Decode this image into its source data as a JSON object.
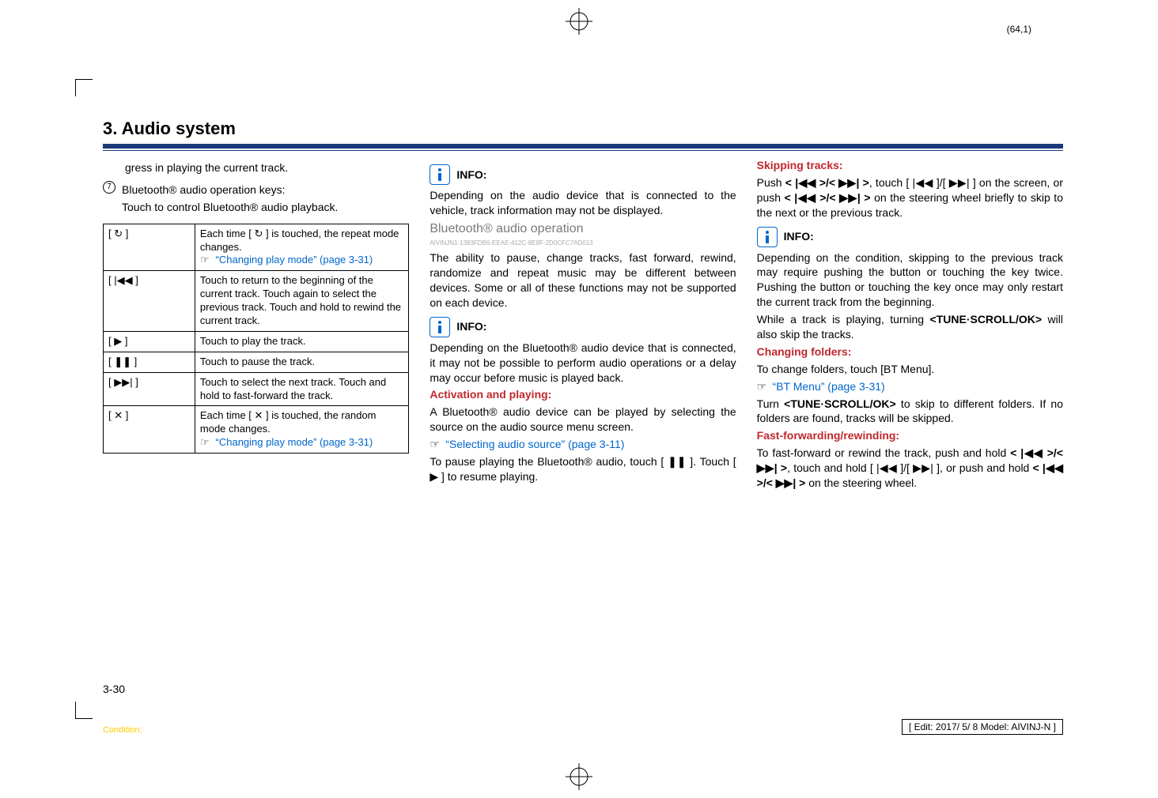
{
  "pageNumTop": "(64,1)",
  "section": {
    "number": "3.",
    "title": "Audio system"
  },
  "col1": {
    "p1": "gress in playing the current track.",
    "num7": "7",
    "bt_keys_label": "Bluetooth® audio operation keys:",
    "bt_keys_desc": "Touch to control Bluetooth® audio playback.",
    "rows": [
      {
        "key": "[ ↻ ]",
        "desc_a": "Each time [ ↻ ] is touched, the repeat mode changes.",
        "link": "“Changing play mode” (page 3-31)"
      },
      {
        "key": "[ |◀◀ ]",
        "desc_a": "Touch to return to the beginning of the current track. Touch again to select the previous track. Touch and hold to rewind the current track."
      },
      {
        "key": "[ ▶ ]",
        "desc_a": "Touch to play the track."
      },
      {
        "key": "[ ❚❚ ]",
        "desc_a": "Touch to pause the track."
      },
      {
        "key": "[ ▶▶| ]",
        "desc_a": "Touch to select the next track. Touch and hold to fast-forward the track."
      },
      {
        "key": "[ ✕ ]",
        "desc_a": "Each time [ ✕ ] is touched, the random mode changes.",
        "link": "“Changing play mode” (page 3-31)"
      }
    ]
  },
  "col2": {
    "info1_label": "INFO:",
    "info1_text": "Depending on the audio device that is connected to the vehicle, track information may not be displayed.",
    "subhead": "Bluetooth® audio operation",
    "subhead_code": "AIVINJN1-1383FDB6-EEAE-412C-8E8F-2D0CFC7AD013",
    "p1": "The ability to pause, change tracks, fast forward, rewind, randomize and repeat music may be different between devices. Some or all of these functions may not be supported on each device.",
    "info2_label": "INFO:",
    "info2_text": "Depending on the Bluetooth® audio device that is connected, it may not be possible to perform audio operations or a delay may occur before music is played back.",
    "act_head": "Activation and playing:",
    "act_p1": "A Bluetooth® audio device can be played by selecting the source on the audio source menu screen.",
    "act_link": "“Selecting audio source” (page 3-11)",
    "act_p2": "To pause playing the Bluetooth® audio, touch [ ❚❚ ]. Touch [ ▶ ] to resume playing."
  },
  "col3": {
    "skip_head": "Skipping tracks:",
    "skip_p1_a": "Push ",
    "skip_p1_b": "< |◀◀ >/< ▶▶| >",
    "skip_p1_c": ", touch [ |◀◀ ]/[ ▶▶| ] on the screen, or push ",
    "skip_p1_d": "< |◀◀ >/< ▶▶| >",
    "skip_p1_e": " on the steering wheel briefly to skip to the next or the previous track.",
    "info_label": "INFO:",
    "info_text": "Depending on the condition, skipping to the previous track may require pushing the button or touching the key twice. Pushing the button or touching the key once may only restart the current track from the beginning.",
    "tune_p_a": "While a track is playing, turning ",
    "tune_p_b": "<TUNE·SCROLL/OK>",
    "tune_p_c": " will also skip the tracks.",
    "chf_head": "Changing folders:",
    "chf_p1": "To change folders, touch [BT Menu].",
    "chf_link": "“BT Menu” (page 3-31)",
    "chf_p2_a": "Turn ",
    "chf_p2_b": "<TUNE·SCROLL/OK>",
    "chf_p2_c": " to skip to different folders. If no folders are found, tracks will be skipped.",
    "ff_head": "Fast-forwarding/rewinding:",
    "ff_p_a": "To fast-forward or rewind the track, push and hold ",
    "ff_p_b": "< |◀◀ >/< ▶▶| >",
    "ff_p_c": ", touch and hold [ |◀◀ ]/[ ▶▶| ], or push and hold ",
    "ff_p_d": "< |◀◀ >/< ▶▶| >",
    "ff_p_e": " on the steering wheel."
  },
  "footer": {
    "page": "3-30",
    "condition": "Condition:",
    "edit": "[ Edit: 2017/ 5/ 8   Model: AIVINJ-N ]"
  }
}
